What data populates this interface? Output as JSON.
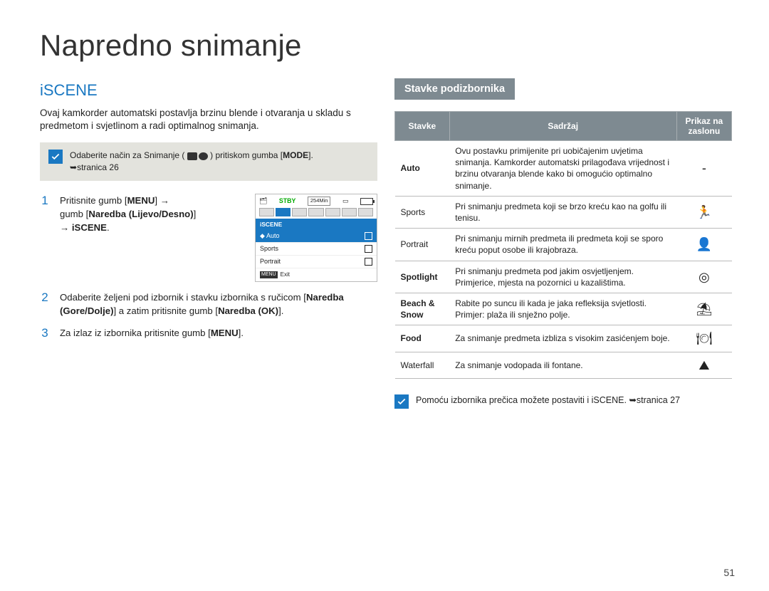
{
  "title": "Napredno snimanje",
  "section": "iSCENE",
  "intro": "Ovaj kamkorder automatski postavlja brzinu blende i otvaranja u skladu s predmetom i svjetlinom a radi optimalnog snimanja.",
  "note1_pre": "Odaberite način za Snimanje (",
  "note1_post": " ) pritiskom gumba [",
  "note1_mode": "MODE",
  "note1_ref": "stranica 26",
  "steps": {
    "s1a": "Pritisnite gumb [",
    "s1b": "MENU",
    "s1c": "]  ",
    "s1d": "gumb [",
    "s1e": "Naredba (Lijevo/Desno)",
    "s1f": "]",
    "s1g": "iSCENE",
    "s2a": "Odaberite željeni pod izbornik i stavku izbornika s ručicom [",
    "s2b": "Naredba (Gore/Dolje)",
    "s2c": "] a zatim pritisnite gumb [",
    "s2d": "Naredba (OK)",
    "s2e": "].",
    "s3a": "Za izlaz iz izbornika pritisnite gumb [",
    "s3b": "MENU",
    "s3c": "]."
  },
  "inset": {
    "stby": "STBY",
    "min": "254Min",
    "label": "iSCENE",
    "items": [
      "Auto",
      "Sports",
      "Portrait"
    ],
    "exit": "Exit",
    "menu": "MENU"
  },
  "subhead": "Stavke podizbornika",
  "table": {
    "h1": "Stavke",
    "h2": "Sadržaj",
    "h3": "Prikaz na zaslonu",
    "rows": [
      {
        "k": "Auto",
        "bold": true,
        "d": "Ovu postavku primijenite pri uobičajenim uvjetima snimanja. Kamkorder automatski prilagođava vrijednost i brzinu otvaranja blende kako bi omogućio optimalno snimanje.",
        "i": "-"
      },
      {
        "k": "Sports",
        "bold": false,
        "d": "Pri snimanju predmeta koji se brzo kreću kao na golfu ili tenisu.",
        "i": "🏃"
      },
      {
        "k": "Portrait",
        "bold": false,
        "d": "Pri snimanju mirnih predmeta ili predmeta koji se sporo kreću poput osobe ili krajobraza.",
        "i": "👤"
      },
      {
        "k": "Spotlight",
        "bold": true,
        "d": "Pri snimanju predmeta pod jakim osvjetljenjem. Primjerice, mjesta na pozornici u kazalištima.",
        "i": "◎"
      },
      {
        "k": "Beach & Snow",
        "bold": true,
        "d": "Rabite po suncu ili kada je jaka refleksija svjetlosti. Primjer: plaža ili snježno polje.",
        "i": "⛱"
      },
      {
        "k": "Food",
        "bold": true,
        "d": "Za snimanje predmeta izbliza s visokim zasićenjem boje.",
        "i": "🍽"
      },
      {
        "k": "Waterfall",
        "bold": false,
        "d": "Za snimanje vodopada ili fontane.",
        "i": "⛰"
      }
    ]
  },
  "footnote": "Pomoću izbornika prečica možete postaviti i iSCENE. ",
  "footnote_ref": "stranica 27",
  "pageno": "51"
}
